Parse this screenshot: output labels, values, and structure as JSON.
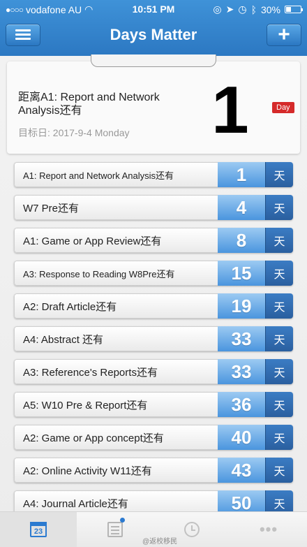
{
  "status": {
    "carrier": "vodafone AU",
    "signal_dots": "●○○○",
    "time": "10:51 PM",
    "battery": "30%"
  },
  "nav": {
    "title": "Days Matter",
    "menu_icon": "hamburger-icon",
    "add_icon": "plus-icon",
    "add_label": "+"
  },
  "hero": {
    "title": "距离A1: Report and Network Analysis还有",
    "date": "目标日: 2017-9-4 Monday",
    "number": "1",
    "unit": "Day"
  },
  "events": [
    {
      "label": "A1: Report and Network Analysis还有",
      "days": "1",
      "unit": "天"
    },
    {
      "label": "W7 Pre还有",
      "days": "4",
      "unit": "天"
    },
    {
      "label": "A1: Game or App Review还有",
      "days": "8",
      "unit": "天"
    },
    {
      "label": "A3: Response to Reading W8Pre还有",
      "days": "15",
      "unit": "天"
    },
    {
      "label": "A2: Draft Article还有",
      "days": "19",
      "unit": "天"
    },
    {
      "label": "A4: Abstract 还有",
      "days": "33",
      "unit": "天"
    },
    {
      "label": "A3: Reference's Reports还有",
      "days": "33",
      "unit": "天"
    },
    {
      "label": "A5: W10 Pre & Report还有",
      "days": "36",
      "unit": "天"
    },
    {
      "label": "A2: Game or App concept还有",
      "days": "40",
      "unit": "天"
    },
    {
      "label": "A2: Online Activity W11还有",
      "days": "43",
      "unit": "天"
    },
    {
      "label": "A4: Journal Article还有",
      "days": "50",
      "unit": "天"
    }
  ],
  "tabbar": {
    "calendar_day": "23",
    "tabs": [
      "calendar-icon",
      "list-icon",
      "clock-icon",
      "more-icon"
    ],
    "more_label": "•••"
  },
  "watermark": "@返校移民"
}
